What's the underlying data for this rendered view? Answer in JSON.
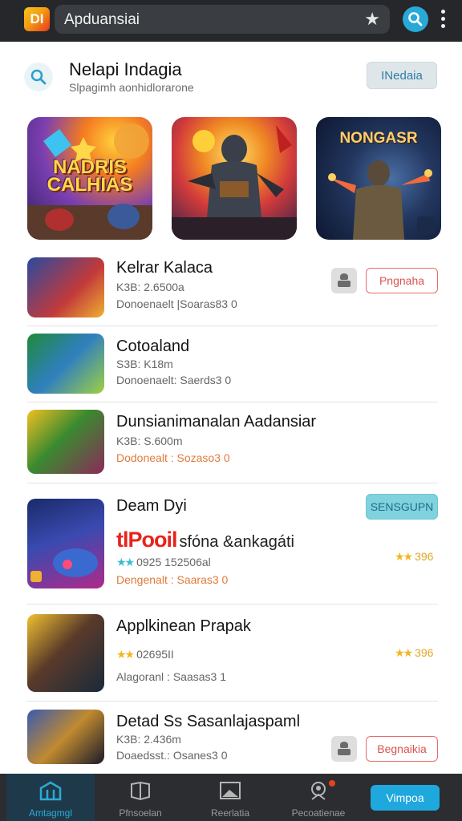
{
  "top_bar": {
    "logo_text": "DI",
    "url_text": "Apduansiai",
    "star_icon": "star-icon",
    "search_icon": "search-icon",
    "menu_icon": "kebab-menu-icon"
  },
  "header": {
    "title": "Nelapi Indagia",
    "subtitle": "Slpagimh aonhidlorarone",
    "button_label": "INedaia"
  },
  "featured": [
    {
      "label": "NADRIS CALHIAS"
    },
    {
      "label": ""
    },
    {
      "label": "NONGASR"
    }
  ],
  "apps": [
    {
      "title": "Kelrar Kalaca",
      "meta": "K3B: 2.6500a",
      "meta2": "Donoenaelt |Soaras83 0",
      "action": "Pngnaha"
    },
    {
      "title": "Cotoaland",
      "meta": "S3B: K18m",
      "meta2": "Donoenaelt: Saerds3 0",
      "action": ""
    },
    {
      "title": "Dunsianimanalan Aadansiar",
      "meta": "K3B: S.600m",
      "meta2": "Dodonealt : Sozaso3 0",
      "action": ""
    },
    {
      "title": "Deam Dyi",
      "brand": "tlPooil",
      "promo": "sfóna &ankagáti",
      "meta": "0925 152506al",
      "meta2": "Dengenalt : Saaras3 0",
      "rating": "396",
      "action": "SENSGUPN"
    },
    {
      "title": "Applkinean Prapak",
      "meta": "02695II",
      "meta2": "Alagoranl : Saasas3 1",
      "rating": "396"
    },
    {
      "title": "Detad Ss Sasanlajaspaml",
      "meta": "K3B: 2.436m",
      "meta2": "Doaedsst.: Osanes3 0",
      "action": "Begnaikia"
    }
  ],
  "bottom_nav": [
    {
      "label": "Amtagmgl",
      "icon": "home-gate-icon"
    },
    {
      "label": "Pfnsoelan",
      "icon": "book-icon"
    },
    {
      "label": "Reerlatia",
      "icon": "image-icon"
    },
    {
      "label": "Pecoatienae",
      "icon": "user-location-icon"
    }
  ],
  "nav_cta": "Vimpoa",
  "colors": {
    "accent": "#1fa8dd",
    "danger": "#d9534f",
    "rating": "#f2b71f",
    "bar": "#25272a"
  }
}
